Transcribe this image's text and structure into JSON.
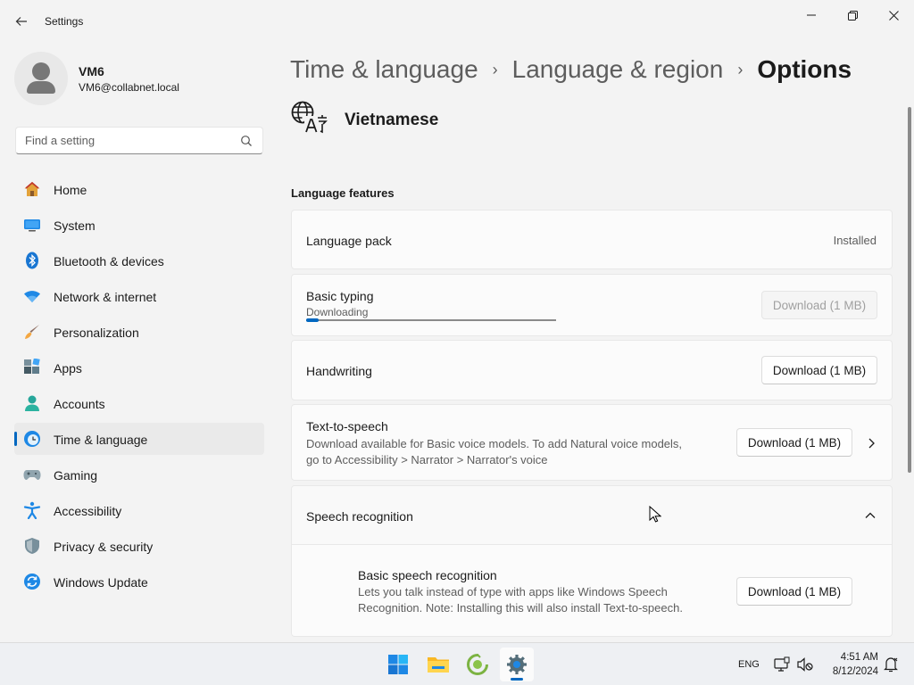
{
  "window": {
    "title": "Settings"
  },
  "profile": {
    "name": "VM6",
    "email": "VM6@collabnet.local"
  },
  "search": {
    "placeholder": "Find a setting"
  },
  "sidebar": {
    "items": [
      {
        "label": "Home",
        "icon": "home-icon"
      },
      {
        "label": "System",
        "icon": "system-icon"
      },
      {
        "label": "Bluetooth & devices",
        "icon": "bluetooth-icon"
      },
      {
        "label": "Network & internet",
        "icon": "wifi-icon"
      },
      {
        "label": "Personalization",
        "icon": "brush-icon"
      },
      {
        "label": "Apps",
        "icon": "apps-icon"
      },
      {
        "label": "Accounts",
        "icon": "accounts-icon"
      },
      {
        "label": "Time & language",
        "icon": "globe-clock-icon",
        "selected": true
      },
      {
        "label": "Gaming",
        "icon": "gamepad-icon"
      },
      {
        "label": "Accessibility",
        "icon": "accessibility-icon"
      },
      {
        "label": "Privacy & security",
        "icon": "shield-icon"
      },
      {
        "label": "Windows Update",
        "icon": "update-icon"
      }
    ]
  },
  "breadcrumb": {
    "items": [
      "Time & language",
      "Language & region"
    ],
    "separator": "›",
    "current": "Options"
  },
  "language": {
    "name": "Vietnamese",
    "icon": "language-icon"
  },
  "features": {
    "section_title": "Language features",
    "language_pack": {
      "label": "Language pack",
      "status": "Installed"
    },
    "basic_typing": {
      "label": "Basic typing",
      "status": "Downloading",
      "progress": 0.05,
      "button": "Download (1 MB)"
    },
    "handwriting": {
      "label": "Handwriting",
      "button": "Download (1 MB)"
    },
    "tts": {
      "label": "Text-to-speech",
      "desc_line1": "Download available for Basic voice models. To add Natural voice models,",
      "desc_line2": "go to Accessibility > Narrator > Narrator's voice",
      "button": "Download (1 MB)"
    },
    "speech": {
      "label": "Speech recognition",
      "expanded": true
    },
    "basic_speech": {
      "label": "Basic speech recognition",
      "desc_line1": "Lets you talk instead of type with apps like Windows Speech",
      "desc_line2": "Recognition. Note: Installing this will also install Text-to-speech.",
      "button": "Download (1 MB)"
    }
  },
  "taskbar": {
    "apps": [
      "start-icon",
      "file-explorer-icon",
      "app-icon",
      "settings-icon"
    ],
    "language": "ENG",
    "time": "4:51 AM",
    "date": "8/12/2024"
  },
  "colors": {
    "accent": "#0067c0",
    "background": "#f3f3f3",
    "card": "#fbfbfb"
  }
}
